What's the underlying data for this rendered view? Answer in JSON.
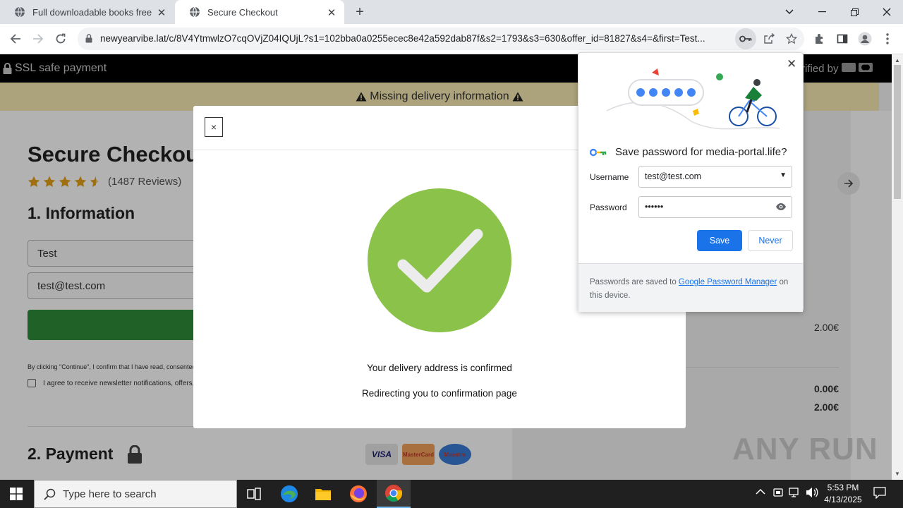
{
  "browser": {
    "tabs": [
      {
        "title": "Full downloadable books free A",
        "close": "✕"
      },
      {
        "title": "Secure Checkout",
        "close": "✕"
      }
    ],
    "new_tab": "+",
    "url": "newyearvibe.lat/c/8V4YtmwlzO7cqOVjZ04IQUjL?s1=102bba0a0255ecec8e42a592dab87f&s2=1793&s3=630&offer_id=81827&s4=&first=Test..."
  },
  "page": {
    "ssl_label": "SSL safe payment",
    "verified_label": "rified by",
    "alert": "Missing delivery information",
    "title": "Secure Checkou",
    "reviews": "(1487 Reviews)",
    "info_heading": "1. Information",
    "first_name": "Test",
    "email": "test@test.com",
    "fineprint": "By clicking \"Continue\", I confirm that I have read, consented to",
    "newsletter": "I agree to receive newsletter notifications, offers, i",
    "payment_heading": "2. Payment",
    "cards": [
      "VISA",
      "MasterCard",
      "Maestro"
    ],
    "prices": {
      "item": "2.00€",
      "shipping": "0.00€",
      "total": "2.00€"
    }
  },
  "modal": {
    "close": "×",
    "line1": "Your delivery address is confirmed",
    "line2": "Redirecting you to confirmation page"
  },
  "password_bubble": {
    "close": "✕",
    "title": "Save password for media-portal.life?",
    "username_label": "Username",
    "username_value": "test@test.com",
    "password_label": "Password",
    "password_value": "••••••",
    "save": "Save",
    "never": "Never",
    "footer_prefix": "Passwords are saved to ",
    "footer_link": "Google Password Manager",
    "footer_suffix": " on this device."
  },
  "taskbar": {
    "search_placeholder": "Type here to search",
    "time": "5:53 PM",
    "date": "4/13/2025"
  },
  "watermark": "ANY RUN",
  "colors": {
    "accent_blue": "#1a73e8",
    "check_green": "#8bc34a",
    "cta_green": "#2f8b3a"
  }
}
